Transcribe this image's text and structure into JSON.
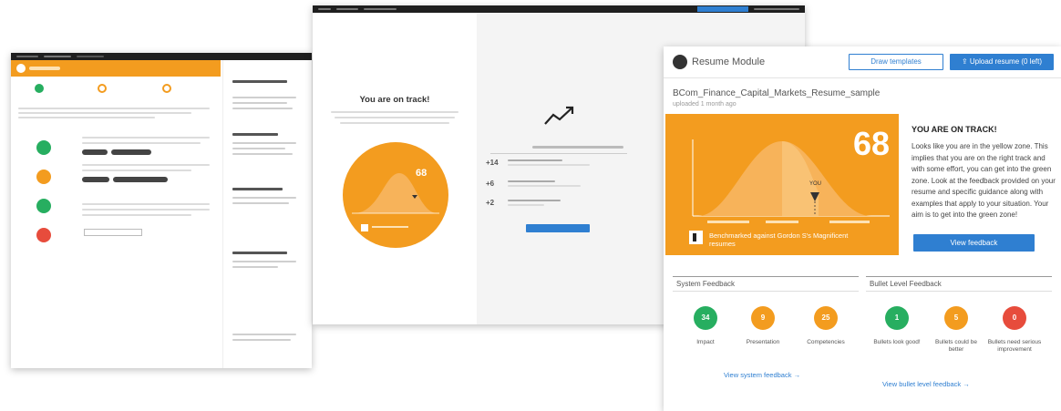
{
  "main": {
    "module_title": "Resume Module",
    "buttons": {
      "draw_templates": "Draw templates",
      "upload_resume": "Upload resume (0 left)"
    },
    "file": {
      "name": "BCom_Finance_Capital_Markets_Resume_sample",
      "uploaded": "uploaded 1 month ago"
    },
    "score": "68",
    "chart_marker": "YOU",
    "benchmark_text": "Benchmarked against Gordon S's Magnificent resumes",
    "status": {
      "title": "YOU ARE ON TRACK!",
      "body": "Looks like you are in the yellow zone. This implies that you are on the right track and with some effort, you can get into the green zone. Look at the feedback provided on your resume and specific guidance along with examples that apply to your situation. Your aim is to get into the green zone!"
    },
    "view_feedback": "View feedback",
    "system_feedback": {
      "label": "System Feedback",
      "items": [
        {
          "value": "34",
          "label": "Impact",
          "color": "#27ae60"
        },
        {
          "value": "9",
          "label": "Presentation",
          "color": "#f39c1f"
        },
        {
          "value": "25",
          "label": "Competencies",
          "color": "#f39c1f"
        }
      ],
      "link": "View system feedback →"
    },
    "bullet_feedback": {
      "label": "Bullet Level Feedback",
      "items": [
        {
          "value": "1",
          "label": "Bullets look good!",
          "color": "#27ae60"
        },
        {
          "value": "5",
          "label": "Bullets could be better",
          "color": "#f39c1f"
        },
        {
          "value": "0",
          "label": "Bullets need serious improvement",
          "color": "#e74c3c"
        }
      ],
      "link": "View bullet level feedback →"
    }
  },
  "middle": {
    "title": "You are on track!",
    "score": "68",
    "feedback_rows": [
      {
        "value": "+14"
      },
      {
        "value": "+6"
      },
      {
        "value": "+2"
      }
    ]
  },
  "colors": {
    "orange": "#f39c1f",
    "green": "#27ae60",
    "red": "#e74c3c",
    "blue": "#2f7fd1"
  }
}
